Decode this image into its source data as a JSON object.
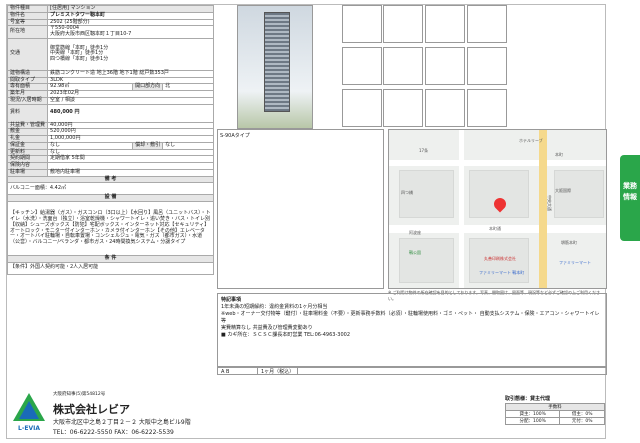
{
  "property": {
    "type_label": "物件種目",
    "type_value": "[住居用] マンション",
    "name_label": "物件名",
    "name_value": "プレミストタワー靱本町",
    "room_label": "号室等",
    "room_value": "2502 (25階部分)",
    "address_label": "所在地",
    "postal": "〒550-0004",
    "address": "大阪府大阪市西区靱本町１丁目10-7",
    "traffic_label": "交通",
    "traffic": [
      "御堂筋線「本町」徒歩1分",
      "中央線「本町」徒歩1分",
      "四つ橋線「本町」徒歩1分"
    ],
    "building_label": "建物構造",
    "building": "鉄筋コンクリート造 地上36階 地下1階 総戸数353戸",
    "layout_label": "間取タイプ",
    "layout": "3LDK",
    "area_label": "専有面積",
    "area": "92.98㎡",
    "dir_label": "開口部方向",
    "dir": "北",
    "built_label": "築年月",
    "built": "2023年02月",
    "status_label": "現況/入居時期",
    "status": "空室 / 相談",
    "rent_label": "賃料",
    "rent": "480,000 円",
    "mgmt_label": "共益費・管理費",
    "mgmt": "40,000円",
    "deposit_label": "敷金",
    "deposit": "520,000円",
    "key_label": "礼金",
    "key": "1,000,000円",
    "keymoney_label": "保証金",
    "keymoney": "なし",
    "amort_label": "償却・敷引",
    "amort": "なし",
    "renew_label": "更新料",
    "renew": "なし",
    "contract_label": "契約期間",
    "contract": "定期借家 5年間",
    "insurance_label": "保険内容",
    "insurance": "",
    "parking_label": "駐車場",
    "parking": "敷地内駐車場"
  },
  "sections": {
    "remarks_title": "備 考",
    "remarks": "バルコニー面積：4.42㎡",
    "equip_title": "設 備",
    "equip": "【キッチン】給湯器（ガス）・ガスコンロ（3口以上）【水回り】風呂（ユニットバス）・トイレ（水洗）・洗面台（独立）・浴室乾燥機・シャワートイレ・追い焚き・バス・トイレ別【収納】シューズボックス【防犯】宅配ボックス・インターネット対応【セキュリティ】オートロック・モニター付インターホン・カメラ付インターホン【その他】エレベーター・オートバイ駐輪場・自転車置場・コンシェルジュ・電気・ガス（都市ガス）・水道（公営）・バルコニー/ベランダ・都市ガス・24時間換気システム・分譲タイプ",
    "cond_title": "条 件",
    "cond": "【条件】外国人契約可能・2人入居可能"
  },
  "photos": {
    "plan_label": "S-90Aタイプ"
  },
  "map": {
    "labels": [
      "17条",
      "ホテルリーブ",
      "本町",
      "四つ橋",
      "大阪国際",
      "ファミリーマート 靱本町",
      "靱公園",
      "本町通",
      "阿波座",
      "堺筋本町",
      "ファミリーマート",
      "丸善印刷株式会社",
      "中央大通"
    ],
    "disclaimer": "※ ご利用は物件の所在確認を目的としております。写真、間取図は、図面等、現況等など必ずご確認の上ご利用ください。"
  },
  "note": {
    "title": "特記事項",
    "lines": [
      "1年未満の短期解約：違約金賃料の1ヶ月分相当",
      "※web・オーナー交付物等（鍵付）・駐車場料金（不要）・更新事務手数料（必須）・駐輪場使用料・ゴミ・ペット・ 自動支払システム・保険・エアコン・シャワートイレ等",
      "実費精算なし 共益費及び管理費変動あり",
      "■ カギ所在：ＳＣＳＣ課長本町営業 TEL:06-4963-3002"
    ]
  },
  "memo": {
    "label": "A B",
    "value": "1ヶ月（税込）"
  },
  "footer": {
    "license": "大阪府知事(5)第54812号",
    "company": "株式会社レビア",
    "address": "大阪市北区中之島２丁目２－２ 大阪中之島ビル9階",
    "tel": "TEL：06-6222-5550 FAX：06-6222-5539",
    "logo_text": "L-EVIA",
    "fee_title": "取引態様：貸主代理",
    "fee_rows": [
      [
        "手数料",
        ""
      ],
      [
        "貸主：100%",
        "借主：0%"
      ],
      [
        "分配：100%",
        "元付：0%"
      ]
    ]
  },
  "tab": "業務情報"
}
